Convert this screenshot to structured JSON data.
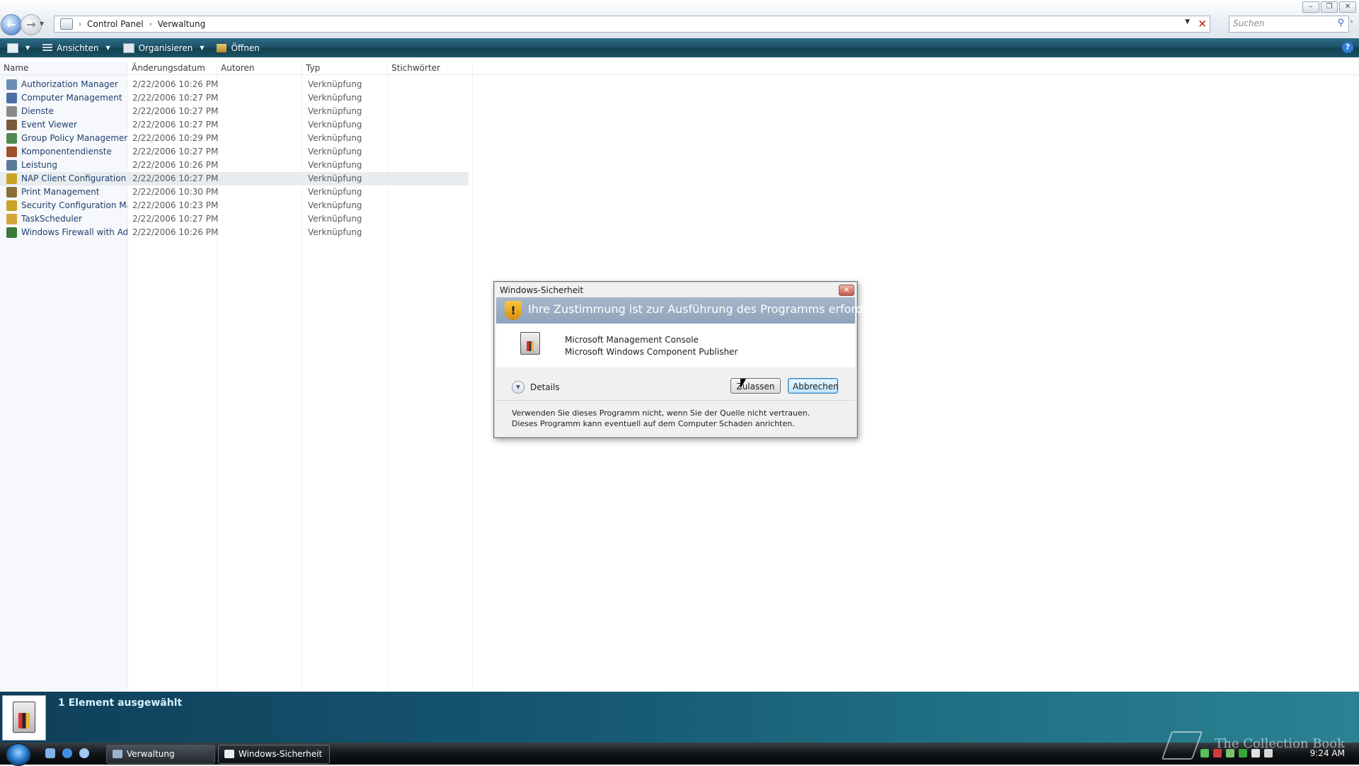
{
  "address": {
    "crumbs": [
      "Control Panel",
      "Verwaltung"
    ],
    "search_placeholder": "Suchen"
  },
  "toolbar": {
    "views_label": "Ansichten",
    "organize_label": "Organisieren",
    "open_label": "Öffnen",
    "help_label": "?"
  },
  "columns": {
    "name": "Name",
    "date": "Änderungsdatum",
    "authors": "Autoren",
    "type": "Typ",
    "tags": "Stichwörter"
  },
  "files": [
    {
      "name": "Authorization Manager",
      "date": "2/22/2006 10:26 PM",
      "type": "Verknüpfung",
      "color": "#6b8fb5"
    },
    {
      "name": "Computer Management",
      "date": "2/22/2006 10:27 PM",
      "type": "Verknüpfung",
      "color": "#4a6fa5"
    },
    {
      "name": "Dienste",
      "date": "2/22/2006 10:27 PM",
      "type": "Verknüpfung",
      "color": "#8a8a8a"
    },
    {
      "name": "Event Viewer",
      "date": "2/22/2006 10:27 PM",
      "type": "Verknüpfung",
      "color": "#7a5a3a"
    },
    {
      "name": "Group Policy Management",
      "date": "2/22/2006 10:29 PM",
      "type": "Verknüpfung",
      "color": "#4f8a4f"
    },
    {
      "name": "Komponentendienste",
      "date": "2/22/2006 10:27 PM",
      "type": "Verknüpfung",
      "color": "#a0522d"
    },
    {
      "name": "Leistung",
      "date": "2/22/2006 10:26 PM",
      "type": "Verknüpfung",
      "color": "#5a7a9a"
    },
    {
      "name": "NAP Client Configuration",
      "date": "2/22/2006 10:27 PM",
      "type": "Verknüpfung",
      "color": "#c9a227"
    },
    {
      "name": "Print Management",
      "date": "2/22/2006 10:30 PM",
      "type": "Verknüpfung",
      "color": "#8b6f3a"
    },
    {
      "name": "Security Configuration Ma...",
      "date": "2/22/2006 10:23 PM",
      "type": "Verknüpfung",
      "color": "#c9a227"
    },
    {
      "name": "TaskScheduler",
      "date": "2/22/2006 10:27 PM",
      "type": "Verknüpfung",
      "color": "#d4a63a"
    },
    {
      "name": "Windows Firewall with Ad...",
      "date": "2/22/2006 10:26 PM",
      "type": "Verknüpfung",
      "color": "#3a7a3a"
    }
  ],
  "dialog": {
    "window_title": "Windows-Sicherheit",
    "heading": "Ihre Zustimmung ist zur Ausführung des Programms erforderlich",
    "program": "Microsoft Management Console",
    "publisher": "Microsoft Windows Component Publisher",
    "details_label": "Details",
    "allow_label": "Zulassen",
    "cancel_label": "Abbrechen",
    "warning": "Verwenden Sie dieses Programm nicht, wenn Sie der Quelle nicht vertrauen. Dieses Programm kann eventuell auf dem Computer Schaden anrichten."
  },
  "details_pane": {
    "selection": "1 Element ausgewählt"
  },
  "taskbar": {
    "tasks": [
      "Verwaltung",
      "Windows-Sicherheit"
    ],
    "clock": "9:24 AM",
    "watermark": "The Collection Book"
  }
}
